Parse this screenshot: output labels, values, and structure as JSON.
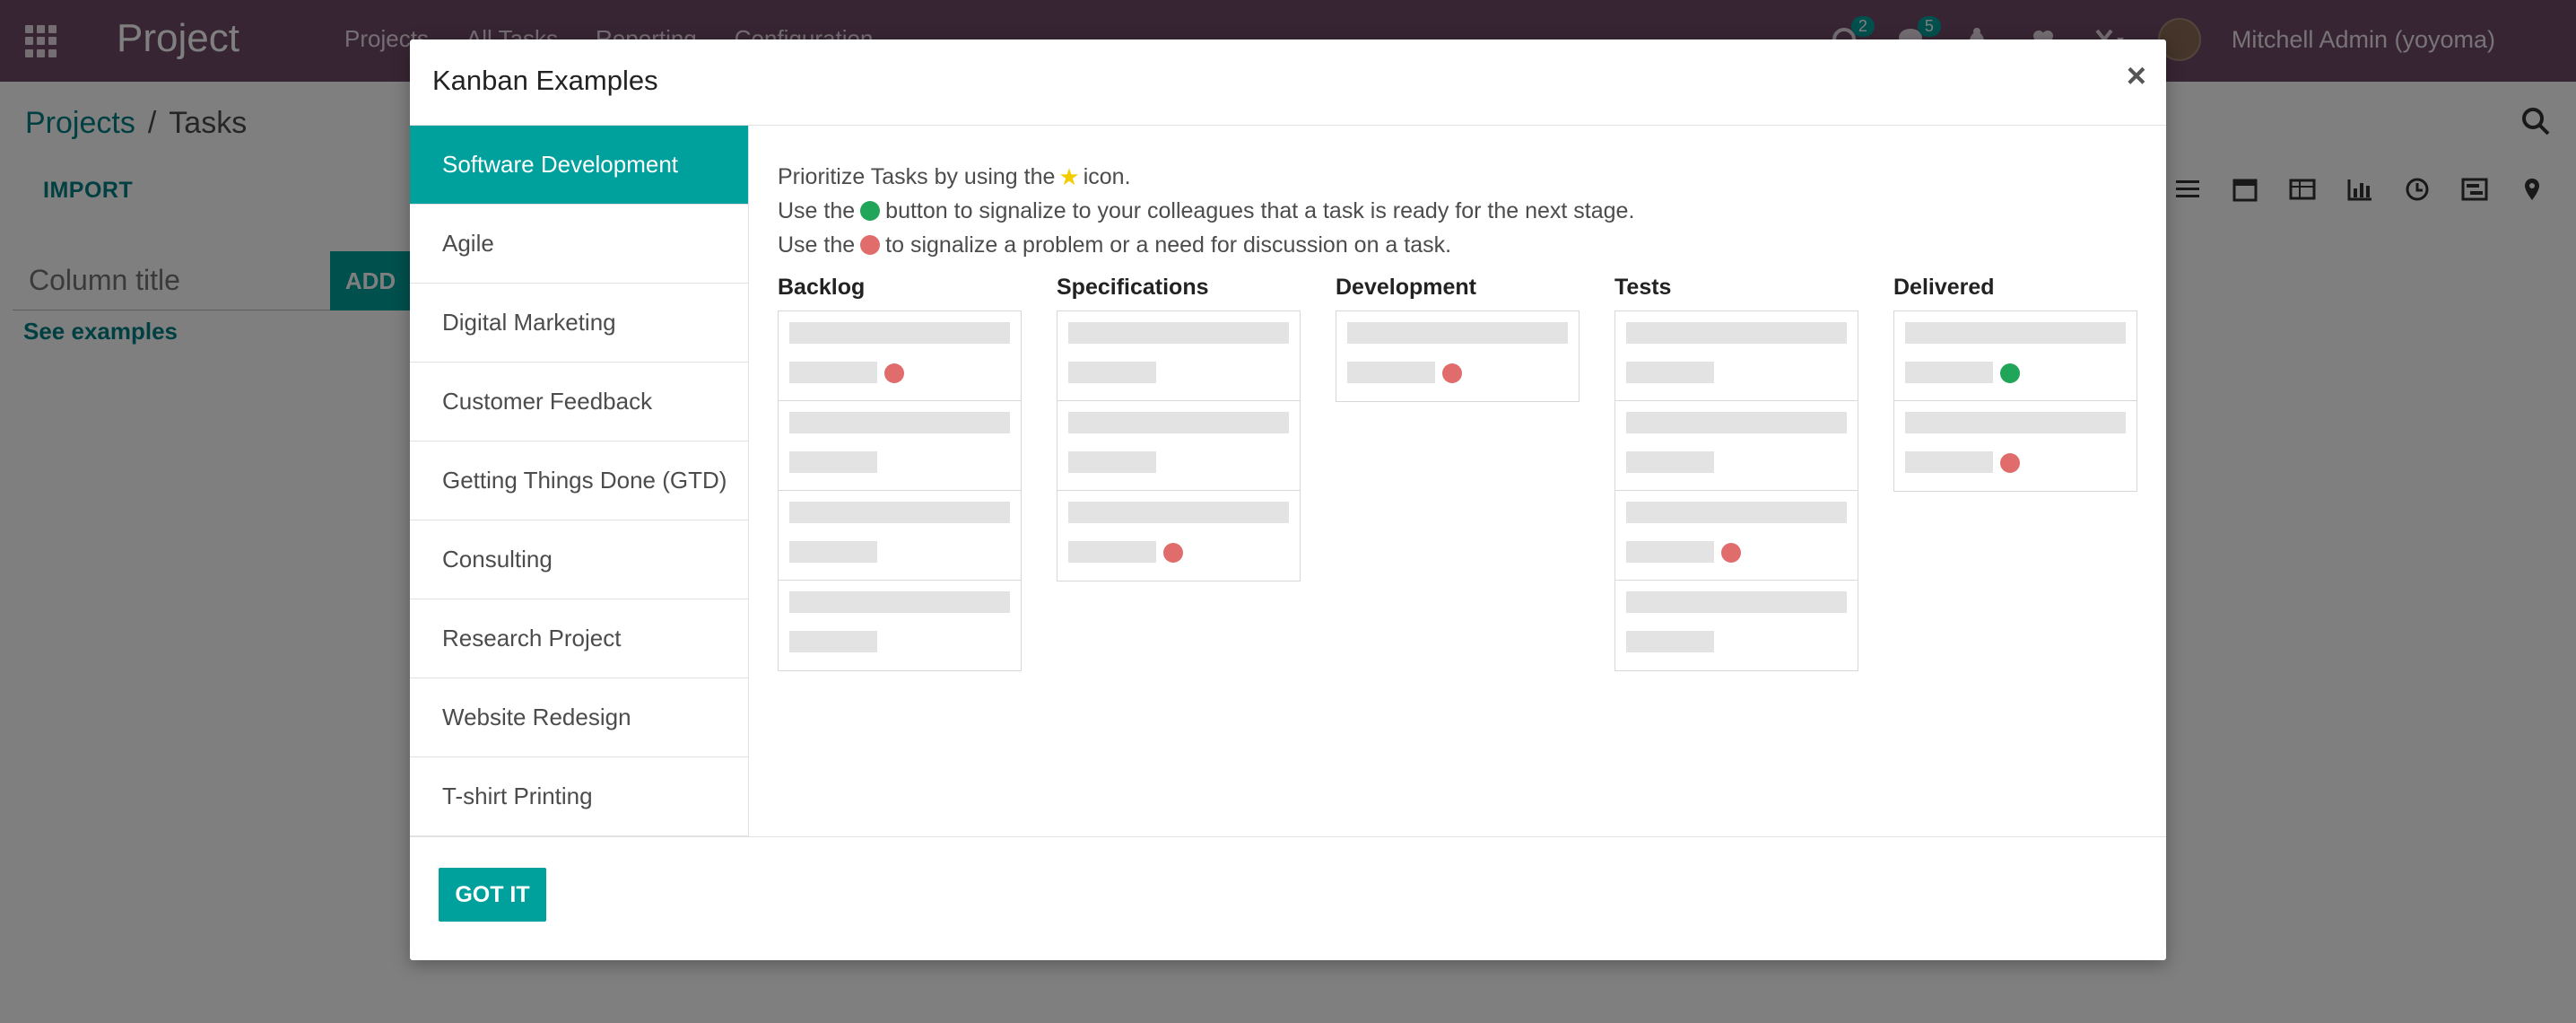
{
  "navbar": {
    "brand": "Project",
    "menu": [
      "Projects",
      "All Tasks",
      "Reporting",
      "Configuration"
    ],
    "activity_count": "2",
    "messages_count": "5",
    "user_name": "Mitchell Admin (yoyoma)"
  },
  "control_panel": {
    "breadcrumb_parent": "Projects",
    "breadcrumb_separator": "/",
    "breadcrumb_current": "Tasks",
    "import_label": "IMPORT"
  },
  "quick_create": {
    "placeholder": "Column title",
    "add_label": "ADD",
    "see_examples": "See examples"
  },
  "modal": {
    "title": "Kanban Examples",
    "close": "×",
    "examples": [
      "Software Development",
      "Agile",
      "Digital Marketing",
      "Customer Feedback",
      "Getting Things Done (GTD)",
      "Consulting",
      "Research Project",
      "Website Redesign",
      "T-shirt Printing"
    ],
    "tips": {
      "line1_pre": "Prioritize Tasks by using the",
      "line1_post": "icon.",
      "line2_pre": "Use the",
      "line2_post": "button to signalize to your colleagues that a task is ready for the next stage.",
      "line3_pre": "Use the",
      "line3_post": "to signalize a problem or a need for discussion on a task."
    },
    "stages": [
      "Backlog",
      "Specifications",
      "Development",
      "Tests",
      "Delivered"
    ],
    "got_it": "GOT IT"
  },
  "colors": {
    "navbar": "#714b67",
    "accent": "#00a09d",
    "link": "#017e84",
    "ready": "#21a559",
    "blocked": "#e06c6c"
  }
}
